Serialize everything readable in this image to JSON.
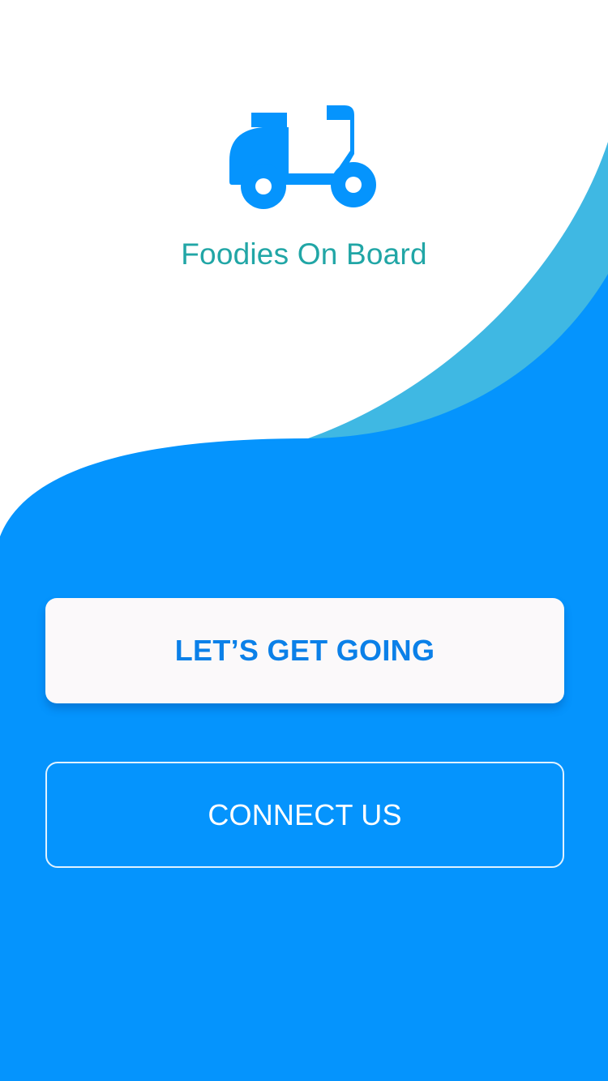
{
  "colors": {
    "primary_blue": "#0594fd",
    "accent_blue": "#3fb8e3",
    "title_teal": "#21a6a6",
    "button_text_blue": "#0b80e8",
    "button_background": "#fbf9fa"
  },
  "branding": {
    "icon_name": "scooter-icon",
    "title": "Foodies On Board"
  },
  "actions": {
    "primary_label": "LET’S GET GOING",
    "secondary_label": "CONNECT US"
  }
}
